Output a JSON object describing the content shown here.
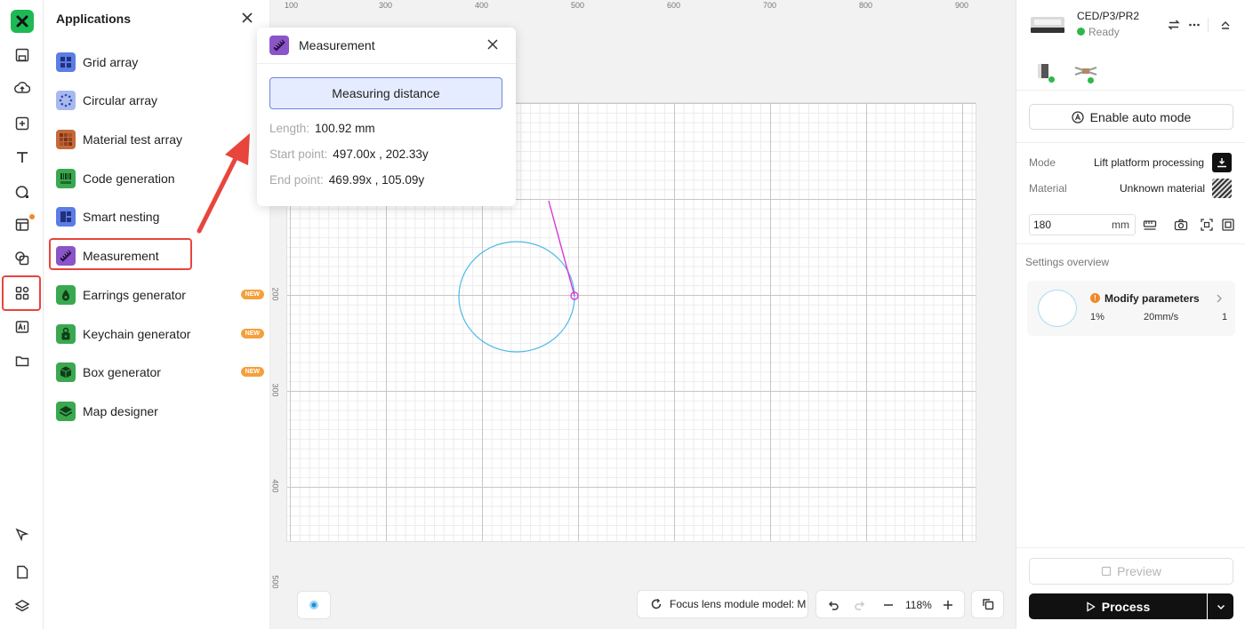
{
  "toolbar": {
    "items": [
      "logo",
      "save-icon",
      "upload-icon",
      "add-shape-icon",
      "text-icon",
      "shape-icon",
      "template-icon",
      "layers-combine-icon",
      "applications-icon",
      "ai-icon",
      "folder-icon",
      "pen-icon",
      "document-icon",
      "layers-icon"
    ],
    "accent": "#1db954",
    "badge_color": "#f08a24",
    "highlight_color": "#e8453c"
  },
  "apps_panel": {
    "title": "Applications",
    "items": [
      {
        "label": "Grid array",
        "icon": "grid-array-icon",
        "color": "#5b7de6",
        "new": false
      },
      {
        "label": "Circular array",
        "icon": "circular-array-icon",
        "color": "#7b9ae8",
        "new": false
      },
      {
        "label": "Material test array",
        "icon": "material-test-icon",
        "color": "#c66a3a",
        "new": false
      },
      {
        "label": "Code generation",
        "icon": "code-generation-icon",
        "color": "#3aa84f",
        "new": false
      },
      {
        "label": "Smart nesting",
        "icon": "smart-nesting-icon",
        "color": "#5b7de6",
        "new": false
      },
      {
        "label": "Measurement",
        "icon": "measurement-icon",
        "color": "#8a55c9",
        "new": false
      },
      {
        "label": "Earrings generator",
        "icon": "earrings-icon",
        "color": "#3aa84f",
        "new": true
      },
      {
        "label": "Keychain generator",
        "icon": "keychain-icon",
        "color": "#3aa84f",
        "new": true
      },
      {
        "label": "Box generator",
        "icon": "box-icon",
        "color": "#3aa84f",
        "new": true
      },
      {
        "label": "Map designer",
        "icon": "map-icon",
        "color": "#3aa84f",
        "new": false
      }
    ],
    "new_label": "NEW"
  },
  "measurement": {
    "title": "Measurement",
    "button": "Measuring distance",
    "length_label": "Length:",
    "length_value": "100.92 mm",
    "start_label": "Start point:",
    "start_value": "497.00x , 202.33y",
    "end_label": "End point:",
    "end_value": "469.99x , 105.09y"
  },
  "ruler": {
    "top": [
      "100",
      "300",
      "400",
      "500",
      "600",
      "700",
      "800",
      "900"
    ],
    "left": [
      "200",
      "300",
      "400",
      "500"
    ]
  },
  "canvas_controls": {
    "focus_label": "Focus lens module model: M",
    "zoom": "118%"
  },
  "device": {
    "name": "CED/P3/PR2",
    "status": "Ready",
    "status_color": "#2fb84a"
  },
  "right_panel": {
    "auto_mode": "Enable auto mode",
    "mode_label": "Mode",
    "mode_value": "Lift platform processing",
    "material_label": "Material",
    "material_value": "Unknown material",
    "height_value": "180",
    "height_unit": "mm",
    "settings_title": "Settings overview",
    "param_title": "Modify parameters",
    "param_power": "1%",
    "param_speed": "20mm/s",
    "param_passes": "1",
    "preview": "Preview",
    "process": "Process"
  }
}
